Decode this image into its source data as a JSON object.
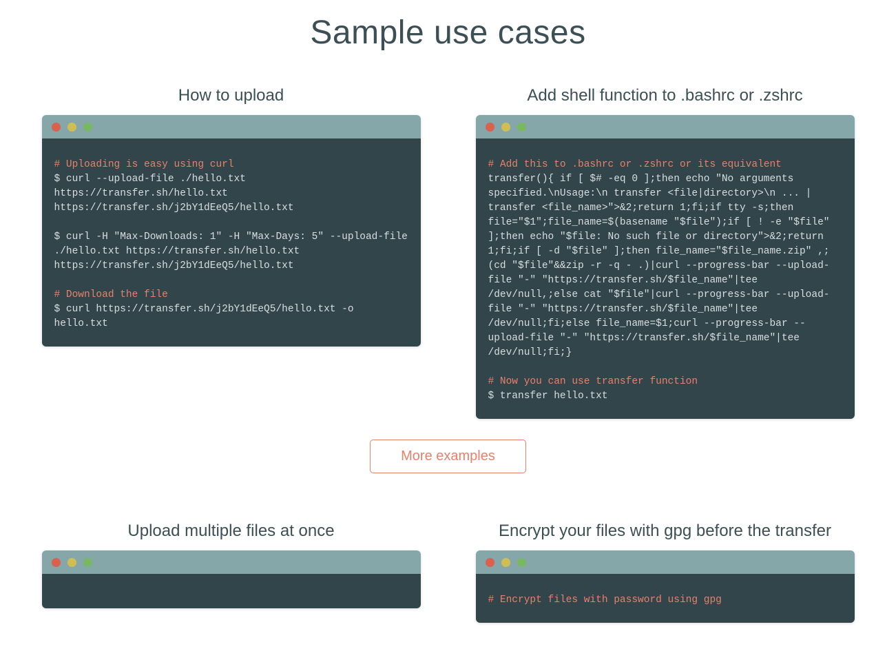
{
  "page_title": "Sample use cases",
  "more_button": "More examples",
  "colors": {
    "accent": "#e9816a",
    "terminal_bg": "#32454b",
    "terminal_top": "#85a7aa",
    "text": "#3c4f55"
  },
  "examples": [
    {
      "title": "How to upload",
      "lines": [
        {
          "t": "comment",
          "text": "# Uploading is easy using curl"
        },
        {
          "t": "cmd",
          "text": "$ curl --upload-file ./hello.txt https://transfer.sh/hello.txt"
        },
        {
          "t": "cmd",
          "text": "https://transfer.sh/j2bY1dEeQ5/hello.txt"
        },
        {
          "t": "blank",
          "text": ""
        },
        {
          "t": "cmd",
          "text": "$ curl -H \"Max-Downloads: 1\" -H \"Max-Days: 5\" --upload-file ./hello.txt https://transfer.sh/hello.txt"
        },
        {
          "t": "cmd",
          "text": "https://transfer.sh/j2bY1dEeQ5/hello.txt"
        },
        {
          "t": "blank",
          "text": ""
        },
        {
          "t": "comment",
          "text": "# Download the file"
        },
        {
          "t": "cmd",
          "text": "$ curl https://transfer.sh/j2bY1dEeQ5/hello.txt -o hello.txt"
        }
      ]
    },
    {
      "title": "Add shell function to .bashrc or .zshrc",
      "lines": [
        {
          "t": "comment",
          "text": "# Add this to .bashrc or .zshrc or its equivalent"
        },
        {
          "t": "cmd",
          "text": "transfer(){ if [ $# -eq 0 ];then echo \"No arguments specified.\\nUsage:\\n transfer <file|directory>\\n ... | transfer <file_name>\">&2;return 1;fi;if tty -s;then file=\"$1\";file_name=$(basename \"$file\");if [ ! -e \"$file\" ];then echo \"$file: No such file or directory\">&2;return 1;fi;if [ -d \"$file\" ];then file_name=\"$file_name.zip\" ,;(cd \"$file\"&&zip -r -q - .)|curl --progress-bar --upload-file \"-\" \"https://transfer.sh/$file_name\"|tee /dev/null,;else cat \"$file\"|curl --progress-bar --upload-file \"-\" \"https://transfer.sh/$file_name\"|tee /dev/null;fi;else file_name=$1;curl --progress-bar --upload-file \"-\" \"https://transfer.sh/$file_name\"|tee /dev/null;fi;}"
        },
        {
          "t": "blank",
          "text": ""
        },
        {
          "t": "comment",
          "text": "# Now you can use transfer function"
        },
        {
          "t": "cmd",
          "text": "$ transfer hello.txt"
        }
      ]
    },
    {
      "title": "Upload multiple files at once",
      "lines": []
    },
    {
      "title": "Encrypt your files with gpg before the transfer",
      "lines": [
        {
          "t": "comment",
          "text": "# Encrypt files with password using gpg"
        }
      ]
    }
  ]
}
